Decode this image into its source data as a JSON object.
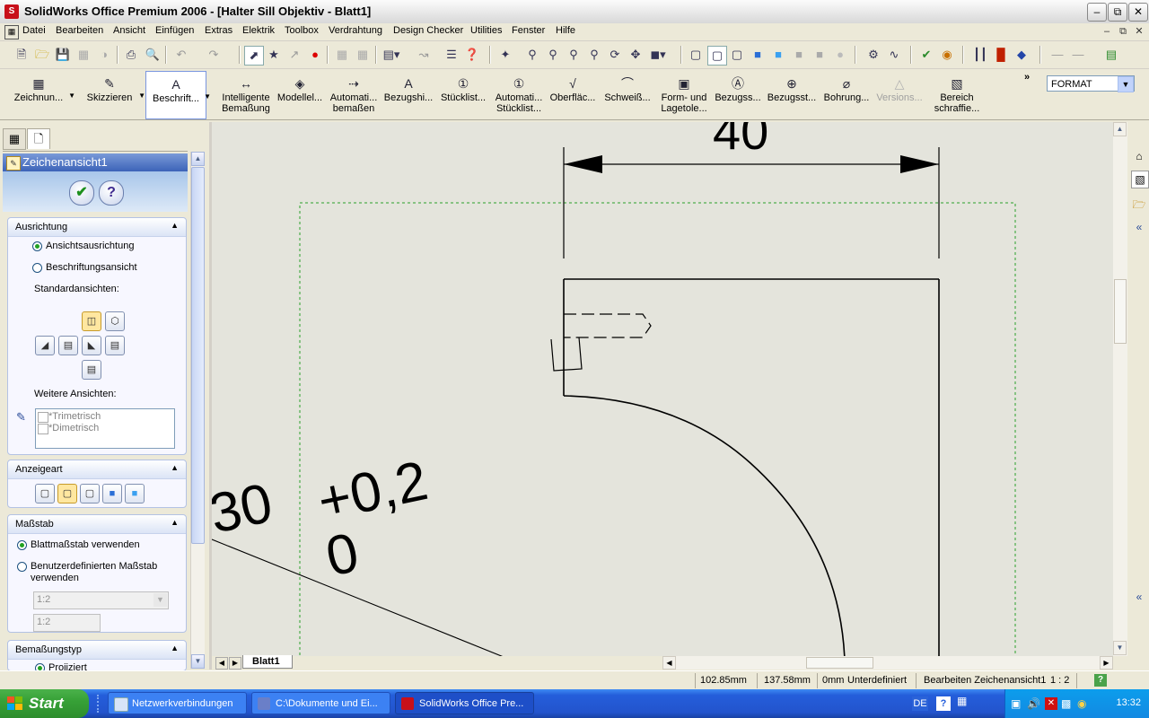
{
  "window": {
    "title": "SolidWorks Office Premium 2006 - [Halter Sill Objektiv - Blatt1]",
    "app_icon": "solidworks-icon",
    "controls": [
      "minimize",
      "restore",
      "close"
    ]
  },
  "menu": [
    "Datei",
    "Bearbeiten",
    "Ansicht",
    "Einfügen",
    "Extras",
    "Elektrik",
    "Toolbox",
    "Verdrahtung",
    "Design Checker",
    "Utilities",
    "Fenster",
    "Hilfe"
  ],
  "command_manager": {
    "items": [
      {
        "label1": "Zeichnun...",
        "label2": "",
        "icon": "drawing-icon",
        "state": "normal"
      },
      {
        "label1": "Skizzieren",
        "label2": "",
        "icon": "sketch-icon",
        "state": "normal"
      },
      {
        "label1": "Beschrift...",
        "label2": "",
        "icon": "annotation-icon",
        "state": "active"
      },
      {
        "label1": "Intelligente",
        "label2": "Bemaßung",
        "icon": "smart-dimension-icon",
        "state": "normal"
      },
      {
        "label1": "Modellel...",
        "label2": "",
        "icon": "model-items-icon",
        "state": "normal"
      },
      {
        "label1": "Automati...",
        "label2": "bemaßen",
        "icon": "auto-dimension-icon",
        "state": "normal"
      },
      {
        "label1": "Bezugshi...",
        "label2": "",
        "icon": "note-icon",
        "state": "normal"
      },
      {
        "label1": "Stücklist...",
        "label2": "",
        "icon": "balloon-icon",
        "state": "normal"
      },
      {
        "label1": "Automati...",
        "label2": "Stücklist...",
        "icon": "auto-balloon-icon",
        "state": "normal"
      },
      {
        "label1": "Oberfläc...",
        "label2": "",
        "icon": "surface-finish-icon",
        "state": "normal"
      },
      {
        "label1": "Schweiß...",
        "label2": "",
        "icon": "weld-symbol-icon",
        "state": "normal"
      },
      {
        "label1": "Form- und",
        "label2": "Lagetole...",
        "icon": "tolerance-icon",
        "state": "normal"
      },
      {
        "label1": "Bezugss...",
        "label2": "",
        "icon": "datum-feature-icon",
        "state": "normal"
      },
      {
        "label1": "Bezugsst...",
        "label2": "",
        "icon": "datum-target-icon",
        "state": "normal"
      },
      {
        "label1": "Bohrung...",
        "label2": "",
        "icon": "hole-callout-icon",
        "state": "normal"
      },
      {
        "label1": "Versions...",
        "label2": "",
        "icon": "revision-icon",
        "state": "disabled"
      },
      {
        "label1": "Bereich",
        "label2": "schraffie...",
        "icon": "hatch-icon",
        "state": "normal"
      }
    ],
    "format_select": "FORMAT"
  },
  "left_panel": {
    "header": "Zeichenansicht1",
    "orientation": {
      "title": "Ausrichtung",
      "radio1": "Ansichtsausrichtung",
      "radio2": "Beschriftungsansicht",
      "standard_label": "Standardansichten:",
      "more_label": "Weitere Ansichten:",
      "more_items": [
        "*Trimetrisch",
        "*Dimetrisch"
      ]
    },
    "display": {
      "title": "Anzeigeart"
    },
    "scale": {
      "title": "Maßstab",
      "radio1": "Blattmaßstab verwenden",
      "radio2a": "Benutzerdefinierten Maßstab",
      "radio2b": "verwenden",
      "select_value": "1:2",
      "input_value": "1:2"
    },
    "dimtype": {
      "title": "Bemaßungstyp",
      "radio1": "Projiziert"
    }
  },
  "drawing": {
    "dim_40": "40",
    "dim_30": "30",
    "tol_upper": "+0,2",
    "tol_lower": "0"
  },
  "sheet_tab": "Blatt1",
  "status": {
    "x": "102.85mm",
    "y": "137.58mm",
    "z": "0mm",
    "state": "Unterdefiniert",
    "mode": "Bearbeiten Zeichenansicht1",
    "scale": "1 : 2"
  },
  "taskbar": {
    "start": "Start",
    "tasks": [
      "Netzwerkverbindungen",
      "C:\\Dokumente und Ei...",
      "SolidWorks Office Pre..."
    ],
    "lang": "DE",
    "clock": "13:32"
  }
}
